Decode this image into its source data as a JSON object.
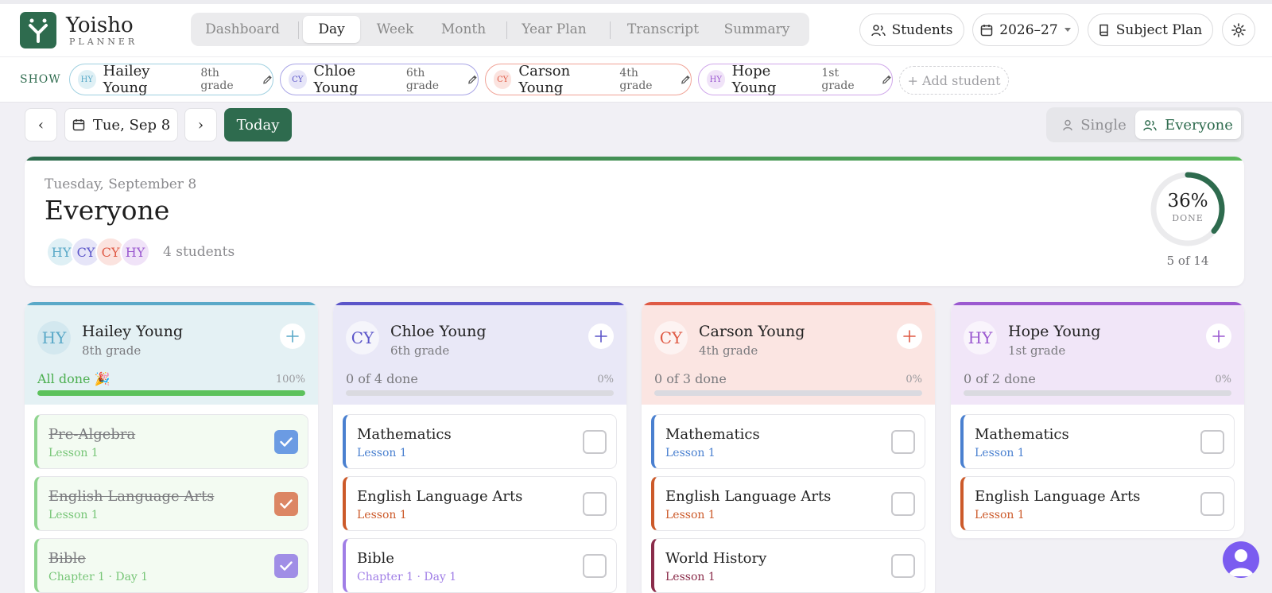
{
  "app": {
    "name": "Yoisho",
    "subtitle": "PLANNER",
    "brand_color": "#2e6b4e"
  },
  "nav": {
    "tabs": [
      "Dashboard",
      "Day",
      "Week",
      "Month",
      "Year Plan",
      "Transcript",
      "Summary"
    ],
    "active": "Day"
  },
  "header_buttons": {
    "students": "Students",
    "year": "2026–27",
    "subject_plan": "Subject Plan",
    "settings_icon": "gear-icon"
  },
  "show": {
    "label": "SHOW",
    "chips": [
      {
        "initials": "HY",
        "name": "Hailey Young",
        "grade": "8th grade",
        "color": "#5aa9c8"
      },
      {
        "initials": "CY",
        "name": "Chloe Young",
        "grade": "6th grade",
        "color": "#5b55c9"
      },
      {
        "initials": "CY",
        "name": "Carson Young",
        "grade": "4th grade",
        "color": "#df5a45"
      },
      {
        "initials": "HY",
        "name": "Hope Young",
        "grade": "1st grade",
        "color": "#9b59d0"
      }
    ],
    "add_label": "+ Add student"
  },
  "controls": {
    "prev": "‹",
    "date": "Tue, Sep 8",
    "next": "›",
    "today": "Today",
    "view_single": "Single",
    "view_everyone": "Everyone",
    "active_view": "Everyone"
  },
  "summary": {
    "date": "Tuesday, September 8",
    "title": "Everyone",
    "avatars": [
      "HY",
      "CY",
      "CY",
      "HY"
    ],
    "student_count": "4 students",
    "percent": "36%",
    "percent_value": 0.36,
    "done_label": "DONE",
    "fraction": "5 of 14"
  },
  "columns": [
    {
      "initials": "HY",
      "name": "Hailey Young",
      "grade": "8th grade",
      "status": "All done 🎉",
      "pct": "100%",
      "progress": 1.0,
      "accent": "#5aa9c8",
      "head_bg": "#e4f1f4",
      "status_color": "#4caf50",
      "fill": "#5cc25c",
      "tasks": [
        {
          "title": "Pre-Algebra",
          "sub": "Lesson 1",
          "done": true,
          "check_color": "#6b9be3",
          "bar": "#8fd48f",
          "sub_color": "#76c576"
        },
        {
          "title": "English Language Arts",
          "sub": "Lesson 1",
          "done": true,
          "check_color": "#dc8664",
          "bar": "#8fd48f",
          "sub_color": "#76c576"
        },
        {
          "title": "Bible",
          "sub": "Chapter 1 · Day 1",
          "done": true,
          "check_color": "#a08ee6",
          "bar": "#8fd48f",
          "sub_color": "#76c576"
        }
      ]
    },
    {
      "initials": "CY",
      "name": "Chloe Young",
      "grade": "6th grade",
      "status": "0 of 4 done",
      "pct": "0%",
      "progress": 0,
      "accent": "#5b55c9",
      "head_bg": "#e9e8f7",
      "status_color": "#7a7a7e",
      "fill": "#5b55c9",
      "tasks": [
        {
          "title": "Mathematics",
          "sub": "Lesson 1",
          "done": false,
          "bar": "#4a80d0",
          "sub_color": "#4a80d0"
        },
        {
          "title": "English Language Arts",
          "sub": "Lesson 1",
          "done": false,
          "bar": "#cc5a2a",
          "sub_color": "#cc5a2a"
        },
        {
          "title": "Bible",
          "sub": "Chapter 1 · Day 1",
          "done": false,
          "bar": "#a07ee6",
          "sub_color": "#a07ee6"
        }
      ]
    },
    {
      "initials": "CY",
      "name": "Carson Young",
      "grade": "4th grade",
      "status": "0 of 3 done",
      "pct": "0%",
      "progress": 0,
      "accent": "#df5a45",
      "head_bg": "#fbe5e2",
      "status_color": "#7a7a7e",
      "fill": "#df5a45",
      "tasks": [
        {
          "title": "Mathematics",
          "sub": "Lesson 1",
          "done": false,
          "bar": "#4a80d0",
          "sub_color": "#4a80d0"
        },
        {
          "title": "English Language Arts",
          "sub": "Lesson 1",
          "done": false,
          "bar": "#cc5a2a",
          "sub_color": "#cc5a2a"
        },
        {
          "title": "World History",
          "sub": "Lesson 1",
          "done": false,
          "bar": "#8a2c4a",
          "sub_color": "#8a2c4a"
        }
      ]
    },
    {
      "initials": "HY",
      "name": "Hope Young",
      "grade": "1st grade",
      "status": "0 of 2 done",
      "pct": "0%",
      "progress": 0,
      "accent": "#9b59d0",
      "head_bg": "#f1e6f8",
      "status_color": "#7a7a7e",
      "fill": "#9b59d0",
      "tasks": [
        {
          "title": "Mathematics",
          "sub": "Lesson 1",
          "done": false,
          "bar": "#4a80d0",
          "sub_color": "#4a80d0"
        },
        {
          "title": "English Language Arts",
          "sub": "Lesson 1",
          "done": false,
          "bar": "#cc5a2a",
          "sub_color": "#cc5a2a"
        }
      ]
    }
  ]
}
